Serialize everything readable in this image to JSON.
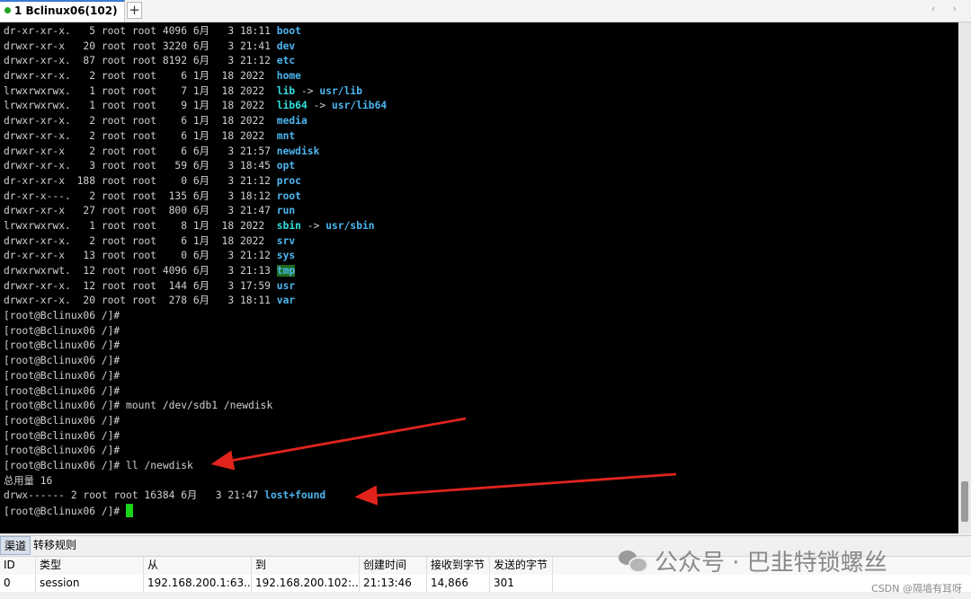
{
  "tab": {
    "title": "1 Bclinux06(102)",
    "add_label": "+",
    "nav": "‹ ›"
  },
  "terminal": {
    "listing": [
      {
        "perm": "dr-xr-xr-x.",
        "links": "  5",
        "owner": "root",
        "group": "root",
        "size": "4096",
        "month": "6月",
        "day": "  3",
        "time": "18:11",
        "name": "boot",
        "target": ""
      },
      {
        "perm": "drwxr-xr-x ",
        "links": " 20",
        "owner": "root",
        "group": "root",
        "size": "3220",
        "month": "6月",
        "day": "  3",
        "time": "21:41",
        "name": "dev",
        "target": ""
      },
      {
        "perm": "drwxr-xr-x.",
        "links": " 87",
        "owner": "root",
        "group": "root",
        "size": "8192",
        "month": "6月",
        "day": "  3",
        "time": "21:12",
        "name": "etc",
        "target": ""
      },
      {
        "perm": "drwxr-xr-x.",
        "links": "  2",
        "owner": "root",
        "group": "root",
        "size": "   6",
        "month": "1月",
        "day": " 18",
        "time": "2022 ",
        "name": "home",
        "target": ""
      },
      {
        "perm": "lrwxrwxrwx.",
        "links": "  1",
        "owner": "root",
        "group": "root",
        "size": "   7",
        "month": "1月",
        "day": " 18",
        "time": "2022 ",
        "name": "lib",
        "target": "usr/lib"
      },
      {
        "perm": "lrwxrwxrwx.",
        "links": "  1",
        "owner": "root",
        "group": "root",
        "size": "   9",
        "month": "1月",
        "day": " 18",
        "time": "2022 ",
        "name": "lib64",
        "target": "usr/lib64"
      },
      {
        "perm": "drwxr-xr-x.",
        "links": "  2",
        "owner": "root",
        "group": "root",
        "size": "   6",
        "month": "1月",
        "day": " 18",
        "time": "2022 ",
        "name": "media",
        "target": ""
      },
      {
        "perm": "drwxr-xr-x.",
        "links": "  2",
        "owner": "root",
        "group": "root",
        "size": "   6",
        "month": "1月",
        "day": " 18",
        "time": "2022 ",
        "name": "mnt",
        "target": ""
      },
      {
        "perm": "drwxr-xr-x ",
        "links": "  2",
        "owner": "root",
        "group": "root",
        "size": "   6",
        "month": "6月",
        "day": "  3",
        "time": "21:57",
        "name": "newdisk",
        "target": ""
      },
      {
        "perm": "drwxr-xr-x.",
        "links": "  3",
        "owner": "root",
        "group": "root",
        "size": "  59",
        "month": "6月",
        "day": "  3",
        "time": "18:45",
        "name": "opt",
        "target": ""
      },
      {
        "perm": "dr-xr-xr-x ",
        "links": "188",
        "owner": "root",
        "group": "root",
        "size": "   0",
        "month": "6月",
        "day": "  3",
        "time": "21:12",
        "name": "proc",
        "target": ""
      },
      {
        "perm": "dr-xr-x---.",
        "links": "  2",
        "owner": "root",
        "group": "root",
        "size": " 135",
        "month": "6月",
        "day": "  3",
        "time": "18:12",
        "name": "root",
        "target": ""
      },
      {
        "perm": "drwxr-xr-x ",
        "links": " 27",
        "owner": "root",
        "group": "root",
        "size": " 800",
        "month": "6月",
        "day": "  3",
        "time": "21:47",
        "name": "run",
        "target": ""
      },
      {
        "perm": "lrwxrwxrwx.",
        "links": "  1",
        "owner": "root",
        "group": "root",
        "size": "   8",
        "month": "1月",
        "day": " 18",
        "time": "2022 ",
        "name": "sbin",
        "target": "usr/sbin"
      },
      {
        "perm": "drwxr-xr-x.",
        "links": "  2",
        "owner": "root",
        "group": "root",
        "size": "   6",
        "month": "1月",
        "day": " 18",
        "time": "2022 ",
        "name": "srv",
        "target": ""
      },
      {
        "perm": "dr-xr-xr-x ",
        "links": " 13",
        "owner": "root",
        "group": "root",
        "size": "   0",
        "month": "6月",
        "day": "  3",
        "time": "21:12",
        "name": "sys",
        "target": ""
      },
      {
        "perm": "drwxrwxrwt.",
        "links": " 12",
        "owner": "root",
        "group": "root",
        "size": "4096",
        "month": "6月",
        "day": "  3",
        "time": "21:13",
        "name": "tmp",
        "target": ""
      },
      {
        "perm": "drwxr-xr-x.",
        "links": " 12",
        "owner": "root",
        "group": "root",
        "size": " 144",
        "month": "6月",
        "day": "  3",
        "time": "17:59",
        "name": "usr",
        "target": ""
      },
      {
        "perm": "drwxr-xr-x.",
        "links": " 20",
        "owner": "root",
        "group": "root",
        "size": " 278",
        "month": "6月",
        "day": "  3",
        "time": "18:11",
        "name": "var",
        "target": ""
      }
    ],
    "arrow_sep": "->",
    "prompt": "[root@Bclinux06 /]#",
    "commands": [
      "",
      "",
      "",
      "",
      "",
      "",
      " mount /dev/sdb1 /newdisk",
      "",
      "",
      "",
      " ll /newdisk"
    ],
    "total_line": "总用量 16",
    "found_entry": {
      "perm": "drwx------",
      "links": "2",
      "owner": "root",
      "group": "root",
      "size": "16384",
      "month": "6月",
      "day": "  3",
      "time": "21:47",
      "name": "lost+found"
    },
    "colors": {
      "dir": "#4db6f0",
      "link": "#32e0e0",
      "cursor": "#19d419",
      "tmp_bg": "#1e6e1e"
    }
  },
  "panel": {
    "tabs": [
      "渠道",
      "转移规则"
    ],
    "columns": [
      "ID",
      "类型",
      "从",
      "到",
      "创建时间",
      "接收到字节",
      "发送的字节"
    ],
    "rows": [
      [
        "0",
        "session",
        "192.168.200.1:63...",
        "192.168.200.102:...",
        "21:13:46",
        "14,866",
        "301"
      ]
    ]
  },
  "watermark": {
    "text": "公众号 · 巴韭特锁螺丝",
    "source": "CSDN @隔墙有耳呀"
  },
  "icons": [
    "session-dot-icon",
    "add-tab-icon",
    "wechat-logo-icon"
  ]
}
